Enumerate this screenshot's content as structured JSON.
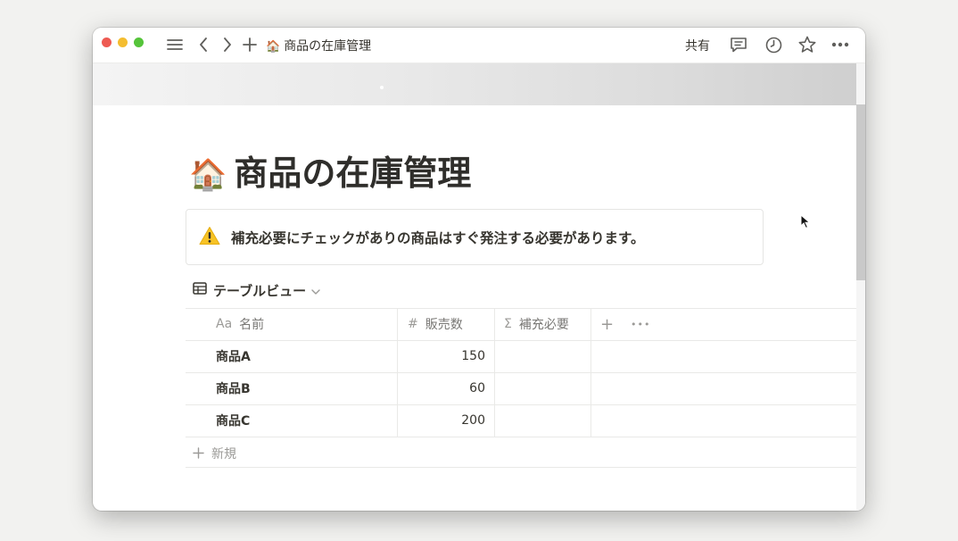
{
  "titlebar": {
    "page_emoji": "🏠",
    "page_title": "商品の在庫管理",
    "share_label": "共有",
    "icons": [
      "sidebar-menu-icon",
      "back-arrow-icon",
      "forward-arrow-icon",
      "plus-icon",
      "comment-icon",
      "history-clock-icon",
      "star-icon",
      "more-icon"
    ]
  },
  "page": {
    "emoji": "🏠",
    "title": "商品の在庫管理",
    "callout": {
      "icon": "⚠️",
      "text": "補充必要にチェックがありの商品はすぐ発注する必要があります。"
    }
  },
  "database": {
    "view_label": "テーブルビュー",
    "columns": [
      {
        "icon": "Aa",
        "label": "名前"
      },
      {
        "icon": "#",
        "label": "販売数"
      },
      {
        "icon": "Σ",
        "label": "補充必要"
      }
    ],
    "add_column": "+",
    "more": "•••",
    "rows": [
      {
        "name": "商品A",
        "sales": "150",
        "restock": ""
      },
      {
        "name": "商品B",
        "sales": "60",
        "restock": ""
      },
      {
        "name": "商品C",
        "sales": "200",
        "restock": ""
      }
    ],
    "new_label": "新規"
  },
  "colors": {
    "text": "#37352f",
    "muted": "#787774",
    "border": "#e9e9e7",
    "close": "#ee5a52",
    "minimize": "#f4bd30",
    "zoom": "#55c43a"
  }
}
